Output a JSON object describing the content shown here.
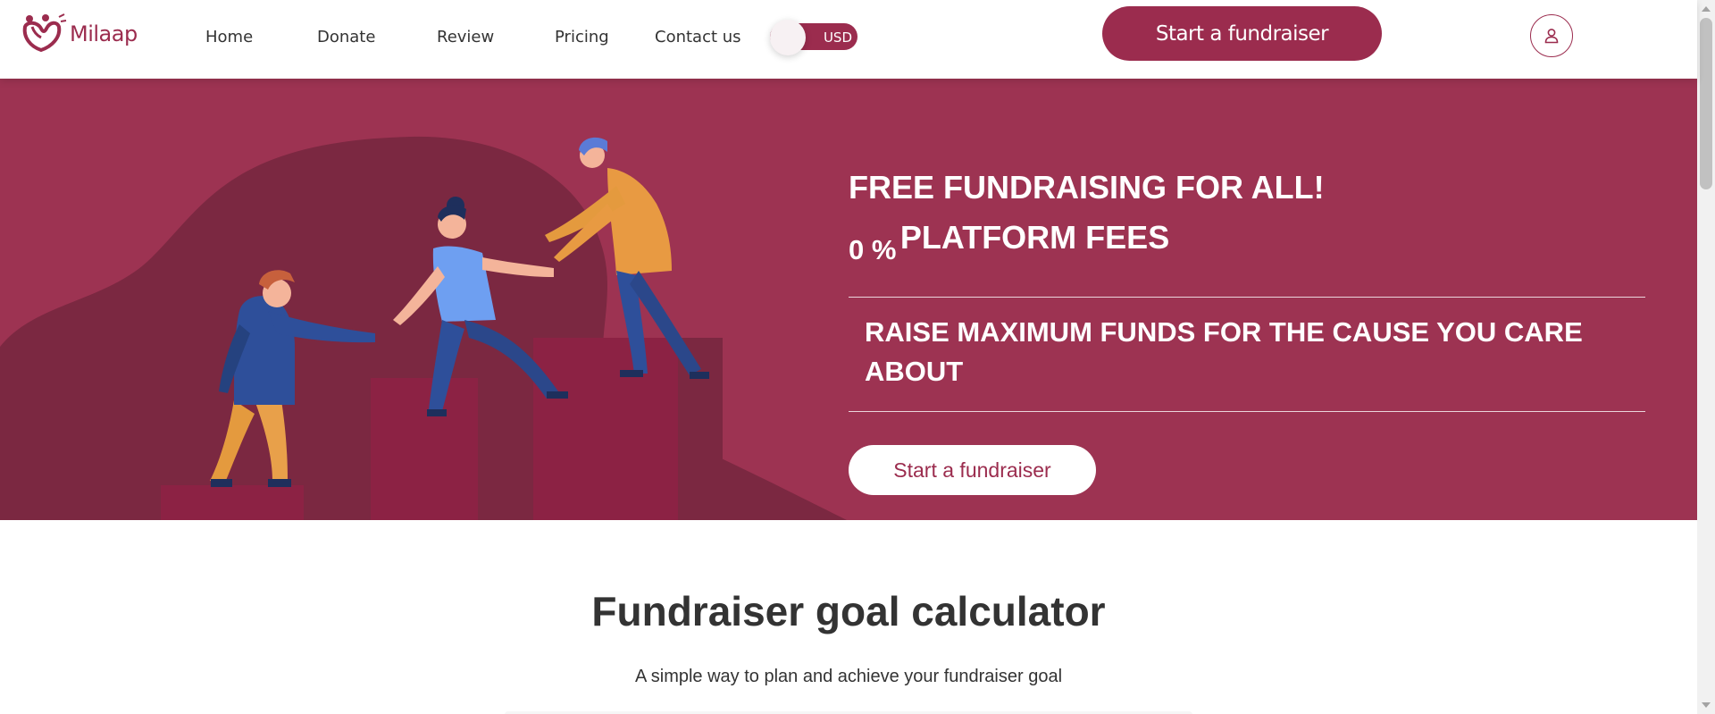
{
  "header": {
    "logo_text": "Milaap",
    "nav": [
      {
        "label": "Home"
      },
      {
        "label": "Donate"
      },
      {
        "label": "Review"
      },
      {
        "label": "Pricing"
      },
      {
        "label": "Contact us"
      }
    ],
    "currency": {
      "label": "USD",
      "enabled": false
    },
    "cta_label": "Start a fundraiser",
    "account_icon": "user-icon"
  },
  "hero": {
    "title": "FREE FUNDRAISING FOR ALL!",
    "fees_value": "0 %",
    "fees_text": "PLATFORM FEES",
    "subtitle": "RAISE MAXIMUM FUNDS FOR THE CAUSE YOU CARE ABOUT",
    "cta_label": "Start a fundraiser"
  },
  "calculator": {
    "title": "Fundraiser goal calculator",
    "subtitle": "A simple way to plan and achieve your fundraiser goal"
  },
  "colors": {
    "brand": "#9b2c4e",
    "hero_bg": "#9d3352",
    "white": "#ffffff",
    "text": "#333333"
  }
}
